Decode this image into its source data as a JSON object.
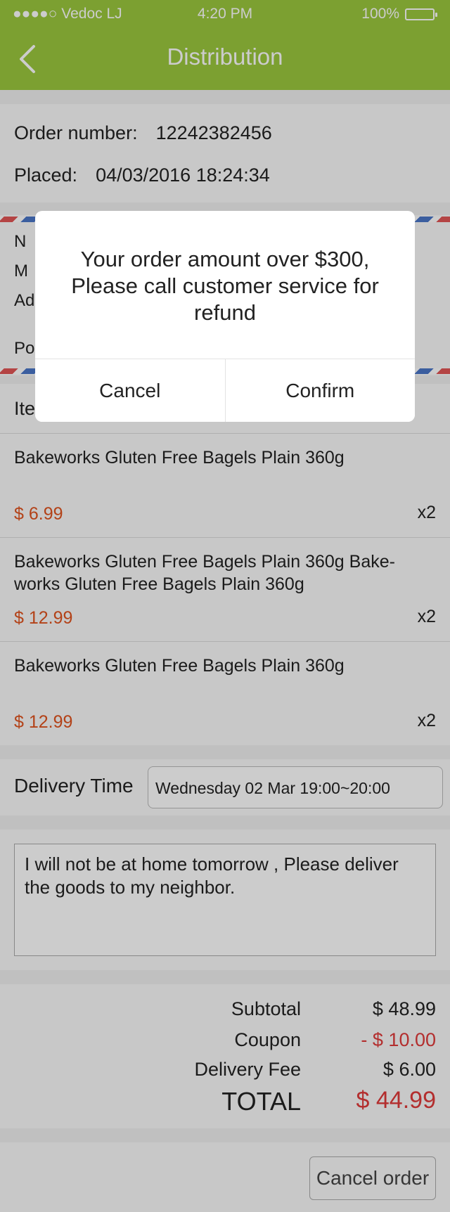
{
  "status_bar": {
    "carrier": "●●●●○ Vedoc LJ",
    "time": "4:20 PM",
    "battery": "100%"
  },
  "nav": {
    "title": "Distribution",
    "back_icon": "chevron-left-icon"
  },
  "order": {
    "number_label": "Order number:",
    "number_value": "12242382456",
    "placed_label": "Placed:",
    "placed_value": "04/03/2016  18:24:34"
  },
  "address": {
    "line1": "N",
    "line2": "M",
    "line3": "Ad",
    "line4": "Po"
  },
  "items_header": "Ite",
  "items": [
    {
      "name": "Bakeworks Gluten Free Bagels Plain 360g",
      "price": "$ 6.99",
      "qty": "x2"
    },
    {
      "name": "Bakeworks Gluten Free Bagels Plain 360g Bake-works Gluten Free Bagels Plain 360g",
      "price": "$ 12.99",
      "qty": "x2"
    },
    {
      "name": "Bakeworks Gluten Free Bagels Plain 360g",
      "price": "$ 12.99",
      "qty": "x2"
    }
  ],
  "delivery": {
    "label": "Delivery Time",
    "value": "Wednesday 02 Mar  19:00~20:00"
  },
  "note": "I will not be at home tomorrow , Please deliver the goods to my neighbor.",
  "summary": {
    "subtotal_label": "Subtotal",
    "subtotal_value": "$ 48.99",
    "coupon_label": "Coupon",
    "coupon_value": "- $ 10.00",
    "fee_label": "Delivery Fee",
    "fee_value": "$ 6.00",
    "total_label": "TOTAL",
    "total_value": "$ 44.99"
  },
  "cancel_order": "Cancel order",
  "dialog": {
    "message": "Your order amount over $300, Please call customer service for refund",
    "cancel": "Cancel",
    "confirm": "Confirm"
  },
  "colors": {
    "brand": "#9bc93e",
    "price": "#e0531f",
    "alert": "#e03a3a"
  }
}
